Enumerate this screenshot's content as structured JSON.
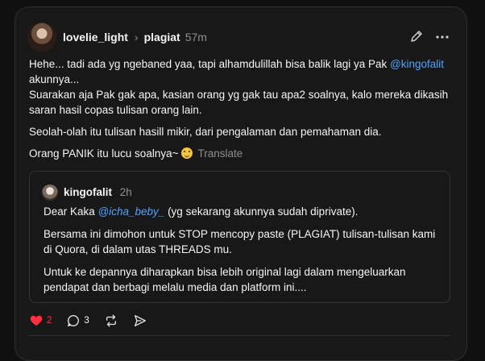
{
  "post": {
    "username": "lovelie_light",
    "topic": "plagiat",
    "time": "57m",
    "lines": {
      "p1a": "Hehe... tadi ada yg ngebaned yaa, tapi alhamdulillah bisa balik lagi ya Pak ",
      "p1_mention": "@kingofalit",
      "p1b": "akunnya...",
      "p2": "Suarakan aja Pak gak apa, kasian orang yg gak tau apa2 soalnya, kalo mereka dikasih saran hasil copas tulisan orang lain.",
      "p3": "Seolah-olah itu tulisan hasill mikir, dari pengalaman dan pemahaman dia.",
      "p4": "Orang PANIK itu lucu soalnya~",
      "translate": "Translate"
    }
  },
  "quote": {
    "username": "kingofalit",
    "time": "2h",
    "q1a": "Dear Kaka ",
    "q1_mention": "@icha_beby_",
    "q1b": " (yg sekarang akunnya sudah diprivate).",
    "q2": "Bersama ini dimohon untuk STOP mencopy paste (PLAGIAT) tulisan-tulisan kami di Quora, di dalam utas THREADS mu.",
    "q3": "Untuk ke depannya diharapkan bisa lebih original lagi dalam mengeluarkan pendapat dan berbagi melalu media dan platform ini...."
  },
  "actions": {
    "likes": "2",
    "replies": "3"
  },
  "colors": {
    "background": "#101010",
    "card": "#181818",
    "mention": "#4ea3ff",
    "like": "#ff3040",
    "muted": "#8f8f8f"
  },
  "icons": [
    "edit-icon",
    "more-icon",
    "heart-icon",
    "reply-icon",
    "repost-icon",
    "share-icon",
    "chevron-right-icon"
  ]
}
